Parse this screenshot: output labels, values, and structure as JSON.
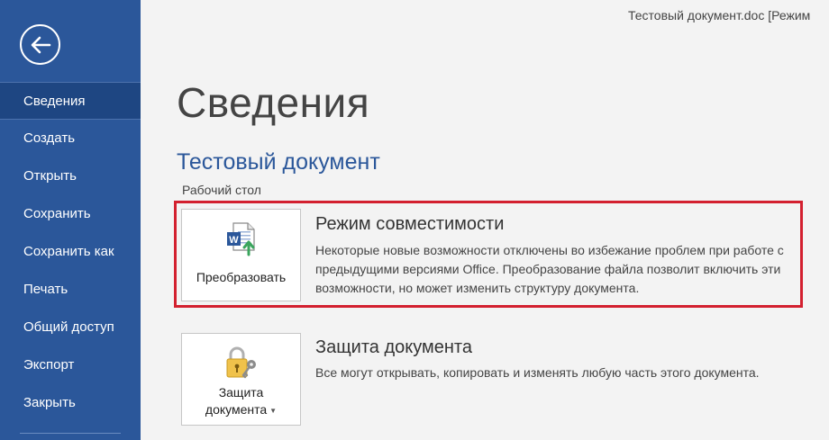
{
  "window": {
    "title": "Тестовый документ.doc [Режим"
  },
  "sidebar": {
    "items": [
      {
        "label": "Сведения",
        "active": true
      },
      {
        "label": "Создать",
        "active": false
      },
      {
        "label": "Открыть",
        "active": false
      },
      {
        "label": "Сохранить",
        "active": false
      },
      {
        "label": "Сохранить как",
        "active": false
      },
      {
        "label": "Печать",
        "active": false
      },
      {
        "label": "Общий доступ",
        "active": false
      },
      {
        "label": "Экспорт",
        "active": false
      },
      {
        "label": "Закрыть",
        "active": false
      }
    ],
    "back_icon": "back-arrow-icon"
  },
  "main": {
    "heading": "Сведения",
    "document_name": "Тестовый документ",
    "document_location": "Рабочий стол",
    "compatibility": {
      "button_label": "Преобразовать",
      "icon": "word-convert-icon",
      "title": "Режим совместимости",
      "description": "Некоторые новые возможности отключены во избежание проблем при работе с предыдущими версиями Office. Преобразование файла позволит включить эти возможности, но может изменить структуру документа."
    },
    "protection": {
      "button_label_line1": "Защита",
      "button_label_line2": "документа",
      "icon": "lock-key-icon",
      "title": "Защита документа",
      "description": "Все могут открывать, копировать и изменять любую часть этого документа."
    }
  },
  "colors": {
    "sidebar": "#2b579a",
    "sidebar_active": "#1e4682",
    "accent_title": "#2b579a",
    "highlight_frame": "#d3202f"
  }
}
